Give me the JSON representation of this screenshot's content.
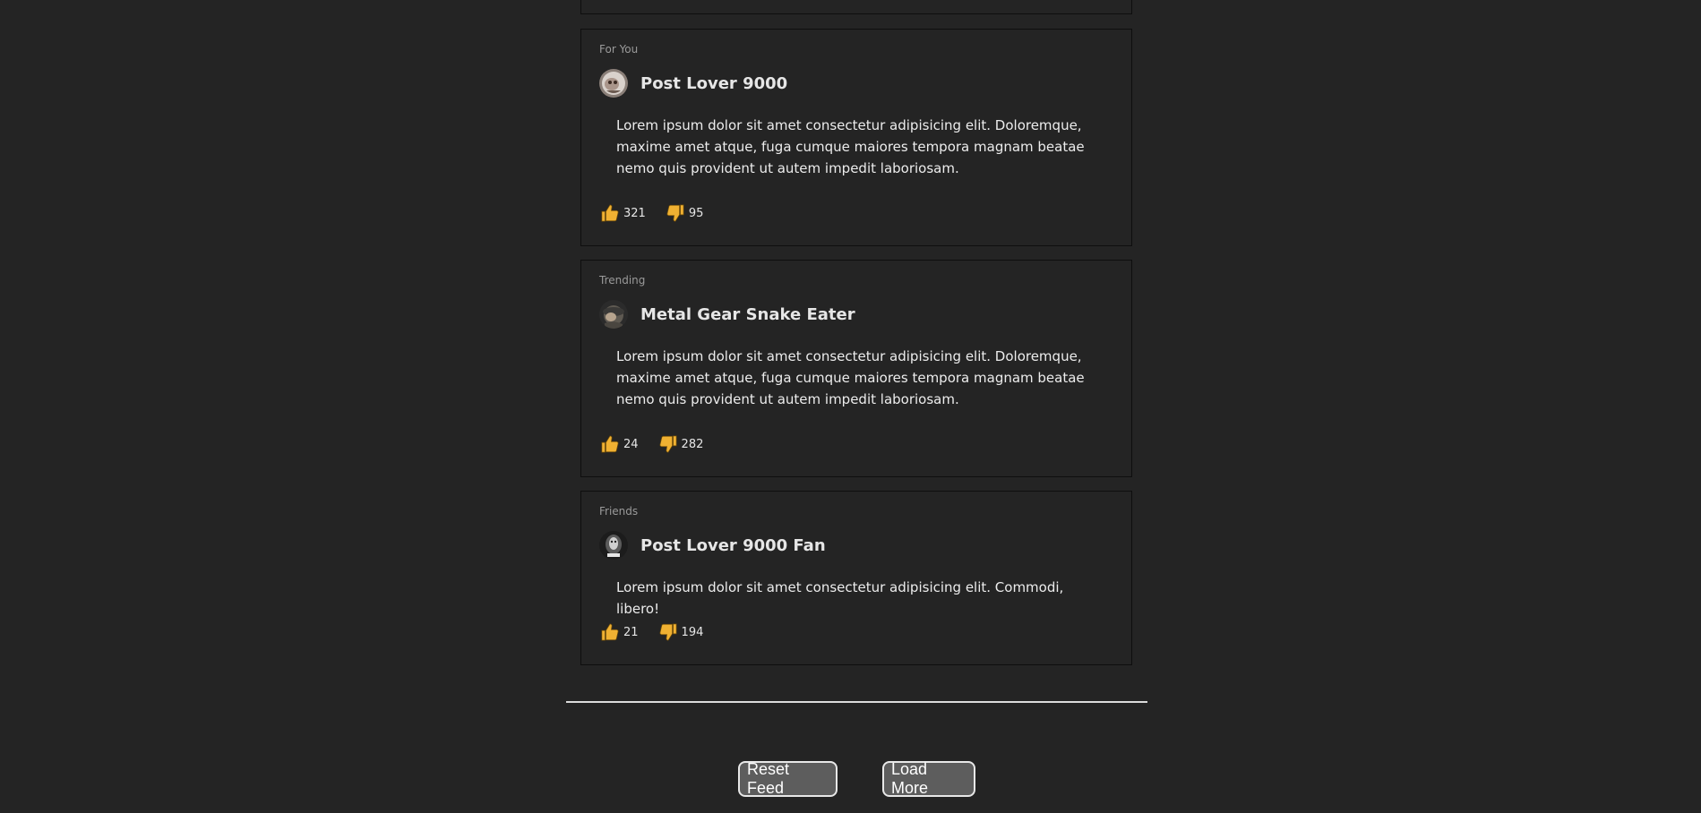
{
  "feed": {
    "posts": [
      {
        "category": "For You",
        "author": "Post Lover 9000",
        "body": "Lorem ipsum dolor sit amet consectetur adipisicing elit. Doloremque, maxime amet atque, fuga cumque maiores tempora magnam beatae nemo quis provident ut autem impedit laboriosam.",
        "likes": "321",
        "dislikes": "95"
      },
      {
        "category": "Trending",
        "author": "Metal Gear Snake Eater",
        "body": "Lorem ipsum dolor sit amet consectetur adipisicing elit. Doloremque, maxime amet atque, fuga cumque maiores tempora magnam beatae nemo quis provident ut autem impedit laboriosam.",
        "likes": "24",
        "dislikes": "282"
      },
      {
        "category": "Friends",
        "author": "Post Lover 9000 Fan",
        "body": "Lorem ipsum dolor sit amet consectetur adipisicing elit. Commodi, libero!",
        "likes": "21",
        "dislikes": "194"
      }
    ]
  },
  "actions": {
    "reset_label": "Reset Feed",
    "load_more_label": "Load More"
  },
  "icons": {
    "like": "thumbs-up-icon",
    "dislike": "thumbs-down-icon"
  },
  "colors": {
    "background": "#242424",
    "reaction_icon": "#f0b132",
    "button_bg": "#5d5d5d"
  }
}
